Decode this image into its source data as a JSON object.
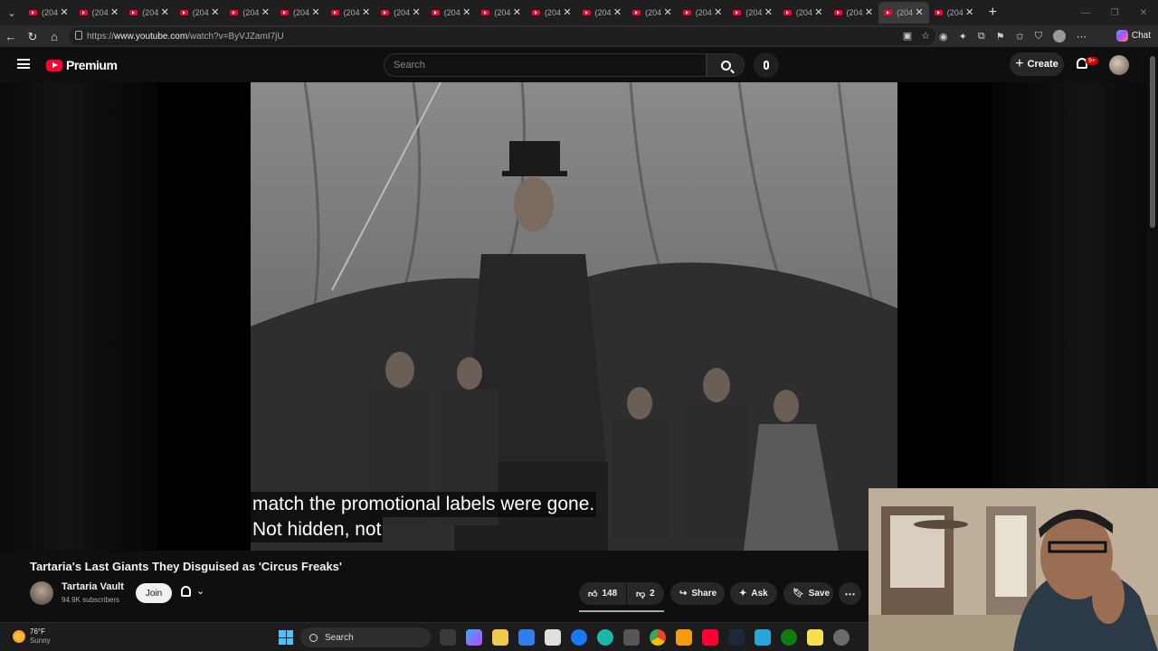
{
  "browser": {
    "tab_title": "(204",
    "tab_count": 19,
    "active_tab_index": 17,
    "url_prefix": "https://",
    "url_host": "www.youtube.com",
    "url_path": "/watch?v=ByVJZamI7jU",
    "chat_label": "Chat"
  },
  "header": {
    "logo_text": "Premium",
    "search_placeholder": "Search",
    "create_label": "Create",
    "notification_badge": "9+"
  },
  "video": {
    "caption_line1": "match the promotional labels were gone.",
    "caption_line2": "Not hidden, not",
    "title": "Tartaria's Last Giants They Disguised as 'Circus Freaks'"
  },
  "channel": {
    "name": "Tartaria Vault",
    "subscribers": "94.9K subscribers",
    "join_label": "Join"
  },
  "actions": {
    "likes": "148",
    "dislikes": "2",
    "share_label": "Share",
    "ask_label": "Ask",
    "save_label": "Save"
  },
  "taskbar": {
    "temperature": "76°F",
    "condition": "Sunny",
    "search_label": "Search"
  },
  "colors": {
    "brand_red": "#ff0033",
    "background": "#0f0f0f",
    "pill": "#272727"
  }
}
